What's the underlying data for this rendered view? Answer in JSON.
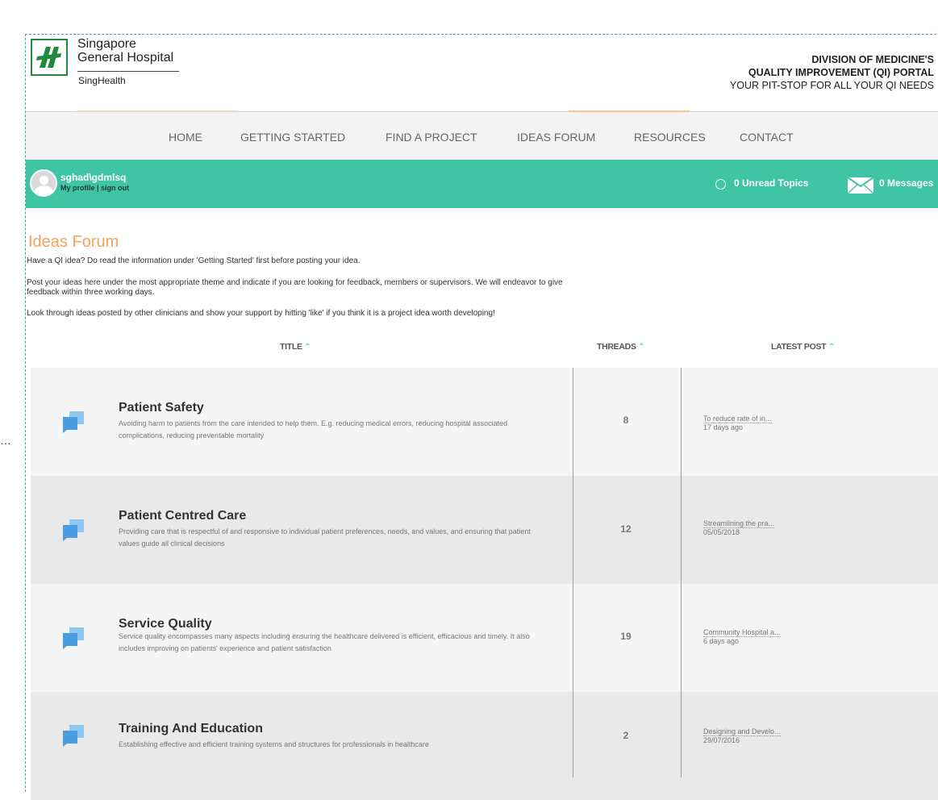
{
  "header": {
    "hospital_line1": "Singapore",
    "hospital_line2": "General Hospital",
    "singhealth": "SingHealth",
    "division_line1": "DIVISION OF MEDICINE'S",
    "division_line2": "QUALITY IMPROVEMENT (QI) PORTAL",
    "division_line3": "YOUR PIT-STOP FOR ALL YOUR QI NEEDS"
  },
  "nav": {
    "items": [
      "HOME",
      "GETTING STARTED",
      "FIND A PROJECT",
      "IDEAS FORUM",
      "RESOURCES",
      "CONTACT"
    ]
  },
  "userbar": {
    "username": "sghad\\gdmlsq",
    "my_profile": "My profile",
    "separator": " | ",
    "sign_out": "sign out",
    "unread": "0 Unread Topics",
    "messages": "0 Messages"
  },
  "page": {
    "title": "Ideas Forum",
    "intro1": "Have a QI idea? Do read the information under 'Getting Started' first before posting your idea.",
    "intro2": "Post your ideas here under the most appropriate theme and indicate if you are looking for feedback, members or supervisors. We will endeavor to give feedback within three working days.",
    "intro3": "Look through ideas posted by other clinicians and show your support by hitting 'like' if you think it is a project idea worth developing!"
  },
  "table": {
    "col_title": "TITLE",
    "col_threads": "THREADS",
    "col_latest": "LATEST POST",
    "sort_arrow": "^",
    "rows": [
      {
        "title": "Patient Safety",
        "description": "Avoiding harm to patients from the care intended to help them. E.g. reducing medical errors, reducing hospital associated complications, reducing preventable mortality",
        "threads": "8",
        "latest_title": "To reduce rate of in...",
        "latest_date": "17 days ago"
      },
      {
        "title": "Patient Centred Care",
        "description": "Providing care that is respectful of and responsive to individual patient preferences, needs, and values, and ensuring that patient values guide all clinical decisions",
        "threads": "12",
        "latest_title": "Streamlining the pra...",
        "latest_date": "05/05/2018"
      },
      {
        "title": "Service Quality",
        "description": "Service quality encompasses many aspects including ensuring the healthcare delivered is efficient, efficacious and timely. It also includes improving on patients' experience and patient satisfaction",
        "threads": "19",
        "latest_title": "Community Hospital a...",
        "latest_date": "6 days ago"
      },
      {
        "title": "Training And Education",
        "description": "Establishing effective and efficient training systems and structures for professionals in healthcare",
        "threads": "2",
        "latest_title": "Designing and Develo...",
        "latest_date": "29/07/2016"
      }
    ]
  },
  "colors": {
    "accent_teal": "#40c4a6",
    "title_orange": "#f5a35c",
    "icon_blue": "#5aa9e6",
    "logo_green": "#1d8a3c"
  }
}
